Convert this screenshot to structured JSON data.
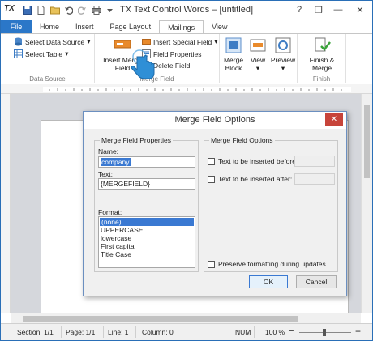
{
  "window": {
    "logo": "TX",
    "title": "TX Text Control Words – [untitled]",
    "controls": {
      "help": "?",
      "restore": "❒",
      "minimize": "—",
      "close": "✕"
    }
  },
  "tabs": [
    {
      "label": "File"
    },
    {
      "label": "Home"
    },
    {
      "label": "Insert"
    },
    {
      "label": "Page Layout"
    },
    {
      "label": "Mailings"
    },
    {
      "label": "View"
    }
  ],
  "ribbon": {
    "data_source": {
      "select_data_source": "Select Data Source",
      "select_table": "Select Table",
      "group_label": "Data Source"
    },
    "merge_field": {
      "insert_merge_field_line1": "Insert Merge",
      "insert_merge_field_line2": "Field",
      "insert_special_field": "Insert Special Field",
      "field_properties": "Field Properties",
      "delete_field": "Delete Field",
      "group_label": "Merge Field"
    },
    "merge_block": {
      "line1": "Merge",
      "line2": "Block"
    },
    "view": {
      "label": "View"
    },
    "preview": {
      "label": "Preview"
    },
    "finish": {
      "line1": "Finish &",
      "line2": "Merge",
      "group_label": "Finish"
    }
  },
  "status": {
    "section": "Section: 1/1",
    "page": "Page: 1/1",
    "line": "Line: 1",
    "column": "Column: 0",
    "num": "NUM",
    "zoom": "100 %",
    "zoom_minus": "−",
    "zoom_plus": "+"
  },
  "dialog": {
    "title": "Merge Field Options",
    "close": "✕",
    "properties_group": "Merge Field Properties",
    "name_label": "Name:",
    "name_value": "company",
    "text_label": "Text:",
    "text_value": "{MERGEFIELD}",
    "format_label": "Format:",
    "format_options": [
      "(none)",
      "UPPERCASE",
      "lowercase",
      "First capital",
      "Title Case"
    ],
    "options_group": "Merge Field Options",
    "before_label": "Text to be inserted before:",
    "after_label": "Text to be inserted after:",
    "preserve_label": "Preserve formatting during updates",
    "ok": "OK",
    "cancel": "Cancel"
  }
}
